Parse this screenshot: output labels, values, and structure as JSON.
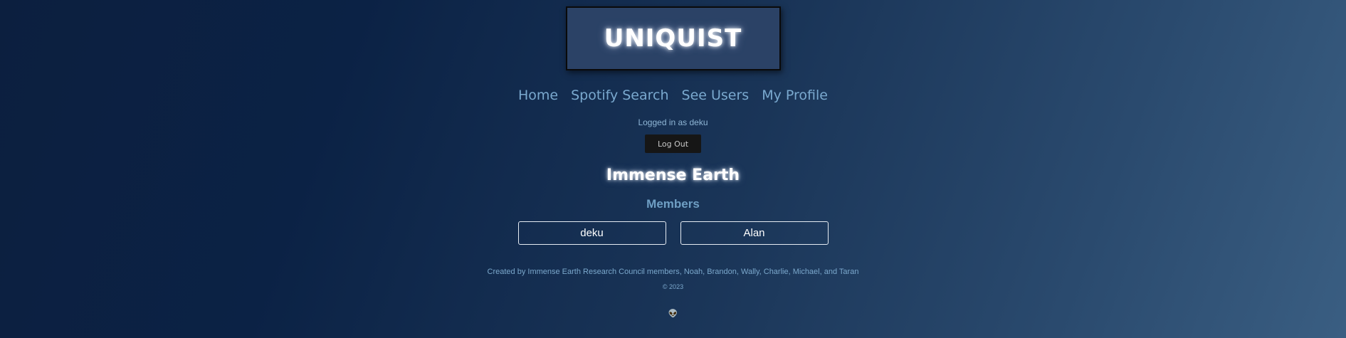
{
  "header": {
    "logo": "UNIQUIST"
  },
  "nav": {
    "items": [
      {
        "label": "Home"
      },
      {
        "label": "Spotify Search"
      },
      {
        "label": "See Users"
      },
      {
        "label": "My Profile"
      }
    ]
  },
  "session": {
    "logged_in_text": "Logged in as deku",
    "logout_label": "Log Out"
  },
  "group": {
    "name": "Immense Earth",
    "members_heading": "Members",
    "members": [
      "deku",
      "Alan"
    ]
  },
  "footer": {
    "credits": "Created by Immense Earth Research Council members, Noah, Brandon, Wally, Charlie, Michael, and Taran",
    "copyright": "© 2023",
    "icon": "alien-icon",
    "icon_glyph": "👽"
  },
  "colors": {
    "accent": "#6f9fc4",
    "logo_box": "#2b4266",
    "button_dark": "#161616"
  }
}
